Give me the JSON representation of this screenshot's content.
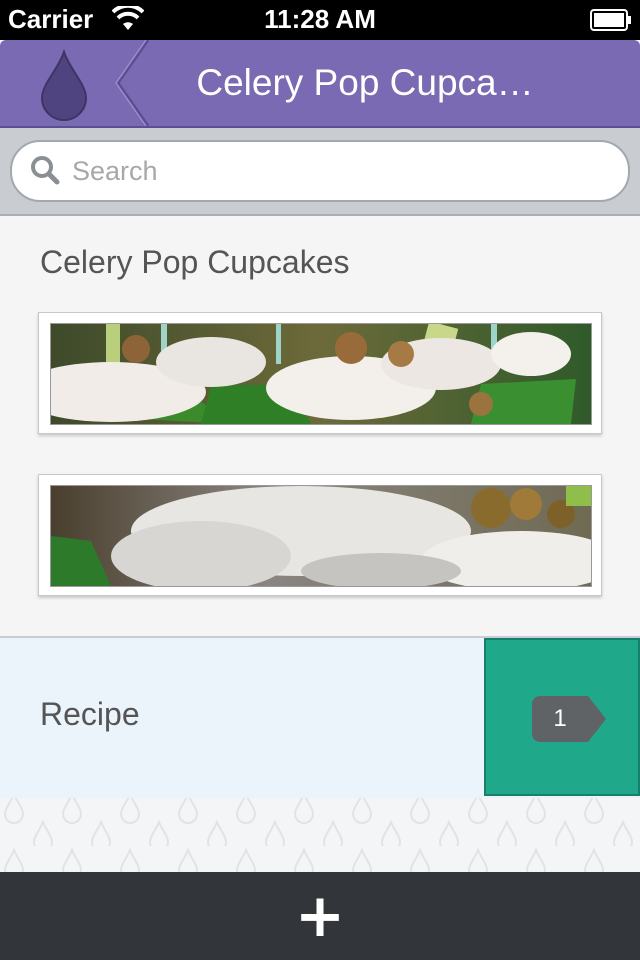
{
  "status_bar": {
    "carrier": "Carrier",
    "time": "11:28 AM"
  },
  "nav": {
    "title": "Celery Pop Cupca…",
    "back_icon": "drop-icon",
    "accent": "#7a6ab3"
  },
  "search": {
    "placeholder": "Search"
  },
  "recipe": {
    "title": "Celery Pop Cupcakes",
    "photos": [
      {
        "name": "cupcake-photo-1"
      },
      {
        "name": "cupcake-photo-2"
      }
    ]
  },
  "section": {
    "label": "Recipe",
    "count": "1",
    "accent": "#1fa98a"
  },
  "toolbar": {
    "add_label": "+"
  }
}
